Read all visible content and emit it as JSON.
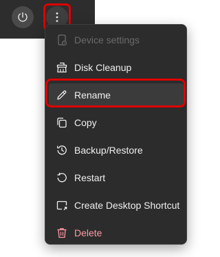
{
  "toolbar": {
    "power_icon": "power-icon",
    "more_icon": "more-vertical-icon"
  },
  "menu": {
    "items": [
      {
        "label": "Device settings",
        "icon": "device-settings-icon",
        "state": "disabled"
      },
      {
        "label": "Disk Cleanup",
        "icon": "broom-icon",
        "state": "normal"
      },
      {
        "label": "Rename",
        "icon": "pencil-icon",
        "state": "hover"
      },
      {
        "label": "Copy",
        "icon": "copy-icon",
        "state": "normal"
      },
      {
        "label": "Backup/Restore",
        "icon": "backup-restore-icon",
        "state": "normal"
      },
      {
        "label": "Restart",
        "icon": "restart-icon",
        "state": "normal"
      },
      {
        "label": "Create Desktop Shortcut",
        "icon": "shortcut-icon",
        "state": "normal"
      },
      {
        "label": "Delete",
        "icon": "trash-icon",
        "state": "danger"
      }
    ]
  },
  "colors": {
    "menu_bg": "#2c2c2c",
    "highlight": "#e00000",
    "danger_text": "#ff99a4",
    "disabled_text": "#6b6b6b"
  }
}
